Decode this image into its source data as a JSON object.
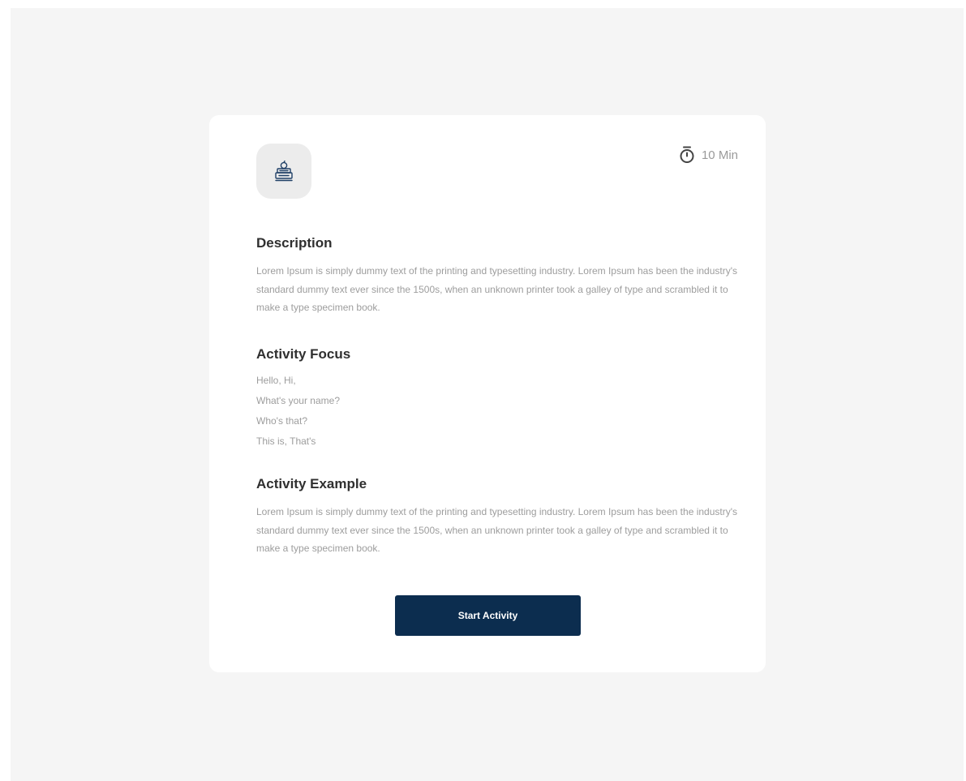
{
  "activity": {
    "icon": "books-with-apple-icon",
    "duration": "10 Min",
    "duration_icon": "stopwatch-icon",
    "description": {
      "title": "Description",
      "text": "Lorem Ipsum is simply dummy text of the printing and typesetting industry. Lorem Ipsum has been the industry's standard dummy text ever since the 1500s, when an unknown printer took a galley of type and scrambled it to make a type specimen book."
    },
    "focus": {
      "title": "Activity Focus",
      "items": [
        "Hello, Hi,",
        "What's your name?",
        "Who's that?",
        "This is, That's"
      ]
    },
    "example": {
      "title": "Activity Example",
      "text": "Lorem Ipsum is simply dummy text of the printing and typesetting industry. Lorem Ipsum has been the industry's standard dummy text ever since the 1500s, when an unknown printer took a galley of type and scrambled it to make a type specimen book."
    },
    "start_button_label": "Start Activity"
  },
  "colors": {
    "background": "#f5f5f5",
    "card": "#ffffff",
    "primary_button": "#0c2d4f",
    "heading": "#2f2f2f",
    "body_text": "#9d9d9d",
    "icon_stroke": "#1e3f66"
  }
}
